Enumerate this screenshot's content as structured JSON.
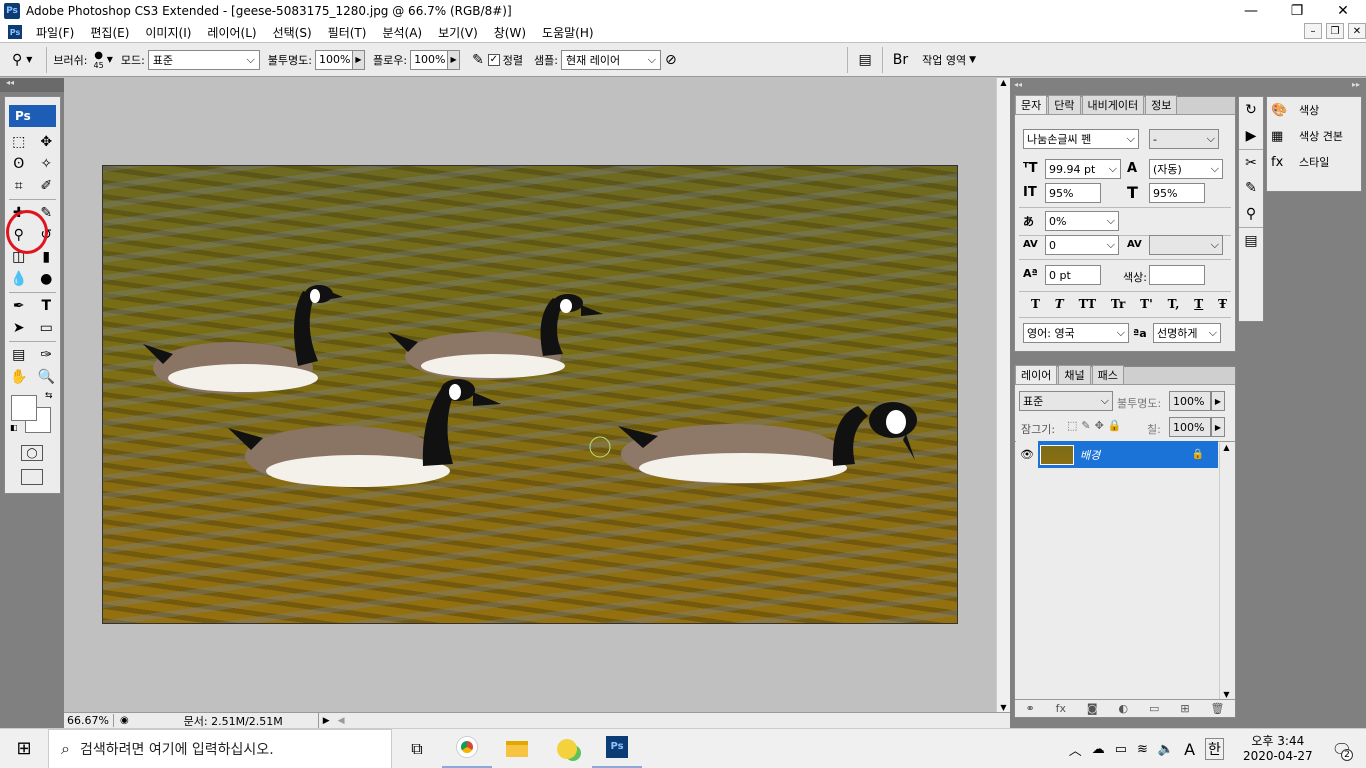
{
  "window": {
    "title": "Adobe Photoshop CS3 Extended - [geese-5083175_1280.jpg @ 66.7% (RGB/8#)]",
    "logo": "Ps"
  },
  "menu": [
    "파일(F)",
    "편집(E)",
    "이미지(I)",
    "레이어(L)",
    "선택(S)",
    "필터(T)",
    "분석(A)",
    "보기(V)",
    "창(W)",
    "도움말(H)"
  ],
  "options": {
    "brush_label": "브러쉬:",
    "brush_size": "45",
    "mode_label": "모드:",
    "mode_value": "표준",
    "opacity_label": "불투명도:",
    "opacity_value": "100%",
    "flow_label": "플로우:",
    "flow_value": "100%",
    "aligned_label": "정렬",
    "sample_label": "샘플:",
    "sample_value": "현재 레이어",
    "workspace_label": "작업 영역"
  },
  "toolbox": {
    "logo": "Ps"
  },
  "status": {
    "zoom": "66.67%",
    "doc": "문서: 2.51M/2.51M"
  },
  "char_panel": {
    "tabs": [
      "문자",
      "단락",
      "내비게이터",
      "정보"
    ],
    "font_family": "나눔손글씨 펜",
    "font_style": "-",
    "font_size": "99.94 pt",
    "leading": "(자동)",
    "vscale": "95%",
    "hscale": "95%",
    "tracking_pct": "0%",
    "kerning": "0",
    "baseline": "0 pt",
    "color_label": "색상:",
    "language": "영어: 영국",
    "antialias": "선명하게",
    "styles": [
      "T",
      "T",
      "TT",
      "Tr",
      "T'",
      "T,",
      "T",
      "Ŧ"
    ]
  },
  "mini_panel": [
    {
      "icon": "color-palette-icon",
      "label": "색상"
    },
    {
      "icon": "swatches-icon",
      "label": "색상 견본"
    },
    {
      "icon": "styles-icon",
      "label": "스타일"
    }
  ],
  "layers_panel": {
    "tabs": [
      "레이어",
      "채널",
      "패스"
    ],
    "blend": "표준",
    "opacity_label": "불투명도:",
    "opacity": "100%",
    "lock_label": "잠그기:",
    "fill_label": "칠:",
    "fill": "100%",
    "layer_name": "배경"
  },
  "taskbar": {
    "search_placeholder": "검색하려면 여기에 입력하십시오.",
    "ime": "A",
    "ime2": "한",
    "time": "오후 3:44",
    "date": "2020-04-27",
    "notif_count": "2"
  },
  "colors": {
    "accent": "#1b73d8",
    "highlight_circle": "#e0141e"
  }
}
